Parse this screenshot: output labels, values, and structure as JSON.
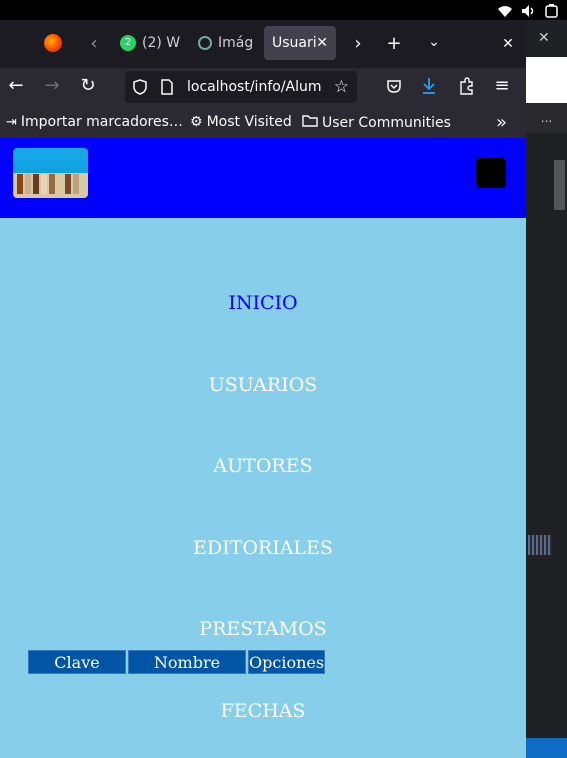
{
  "browser": {
    "tabs": [
      {
        "label": "(2) W",
        "badge": "2"
      },
      {
        "label": "Imág"
      },
      {
        "label": "Usuari",
        "active": true
      }
    ],
    "url": "localhost/info/Alum",
    "bookmarks": [
      {
        "label": "Importar marcadores…"
      },
      {
        "label": "Most Visited"
      },
      {
        "label": "User Communities"
      }
    ]
  },
  "page": {
    "nav": [
      {
        "label": "INICIO",
        "active": true
      },
      {
        "label": "USUARIOS"
      },
      {
        "label": "AUTORES"
      },
      {
        "label": "EDITORIALES"
      },
      {
        "label": "PRESTAMOS"
      },
      {
        "label": "FECHAS"
      }
    ],
    "table": {
      "headers": [
        "Clave",
        "Nombre",
        "Opciones"
      ]
    }
  },
  "side": {
    "menu_label": "..."
  },
  "colors": {
    "header_bg": "#0000ff",
    "page_bg": "#87ceeb",
    "table_header_bg": "#0055a5",
    "active_link": "#0000ff"
  }
}
